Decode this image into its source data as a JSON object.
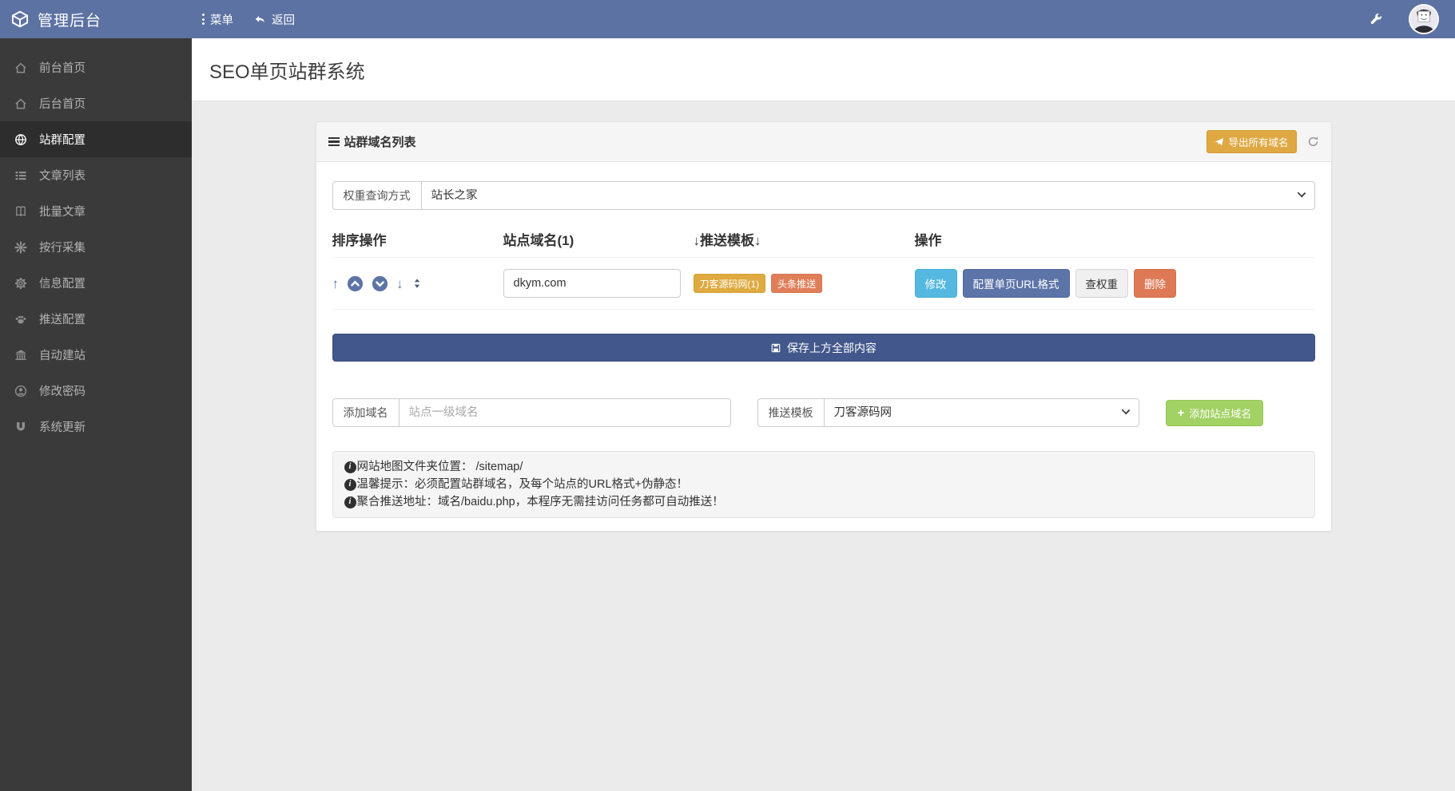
{
  "topbar": {
    "brand": "管理后台",
    "menu_label": "菜单",
    "back_label": "返回"
  },
  "sidebar": {
    "items": [
      {
        "label": "前台首页",
        "icon": "home-icon",
        "active": false
      },
      {
        "label": "后台首页",
        "icon": "home-icon",
        "active": false
      },
      {
        "label": "站群配置",
        "icon": "globe-icon",
        "active": true
      },
      {
        "label": "文章列表",
        "icon": "list-icon",
        "active": false
      },
      {
        "label": "批量文章",
        "icon": "book-icon",
        "active": false
      },
      {
        "label": "按行采集",
        "icon": "burst-icon",
        "active": false
      },
      {
        "label": "信息配置",
        "icon": "gear-icon",
        "active": false
      },
      {
        "label": "推送配置",
        "icon": "paw-icon",
        "active": false
      },
      {
        "label": "自动建站",
        "icon": "bank-icon",
        "active": false
      },
      {
        "label": "修改密码",
        "icon": "user-circle-icon",
        "active": false
      },
      {
        "label": "系统更新",
        "icon": "magnet-icon",
        "active": false
      }
    ]
  },
  "page": {
    "title": "SEO单页站群系统"
  },
  "panel": {
    "title": "站群域名列表",
    "export_label": "导出所有域名",
    "weight_query": {
      "label": "权重查询方式",
      "value": "站长之家"
    },
    "table": {
      "headers": [
        "排序操作",
        "站点域名(1)",
        "↓推送模板↓",
        "操作"
      ],
      "row": {
        "domain": "dkym.com",
        "tags": [
          {
            "label": "刀客源码网(1)",
            "color": "#dfaa3f"
          },
          {
            "label": "头条推送",
            "color": "#df7f5a"
          }
        ],
        "actions": [
          {
            "label": "修改",
            "color": "#55b8e0"
          },
          {
            "label": "配置单页URL格式",
            "color": "#5d74a8"
          },
          {
            "label": "查权重",
            "color": "#f0f0f0"
          },
          {
            "label": "删除",
            "color": "#dd7a55"
          }
        ]
      }
    },
    "save_label": "保存上方全部内容",
    "add_domain": {
      "label": "添加域名",
      "placeholder": "站点一级域名"
    },
    "push_template": {
      "label": "推送模板",
      "value": "刀客源码网"
    },
    "add_label": "添加站点域名",
    "notes": [
      "网站地图文件夹位置： /sitemap/",
      "温馨提示：必须配置站群域名，及每个站点的URL格式+伪静态！",
      "聚合推送地址：域名/baidu.php，本程序无需挂访问任务都可自动推送！"
    ]
  },
  "colors": {
    "topbar": "#5c72a3",
    "sidebar": "#3a3a3a",
    "accent_indigo": "#5d74a8",
    "warning": "#dfa843",
    "danger": "#dd7a55",
    "info": "#55b8e0",
    "success": "#a2d164",
    "save_bar": "#42578b"
  }
}
